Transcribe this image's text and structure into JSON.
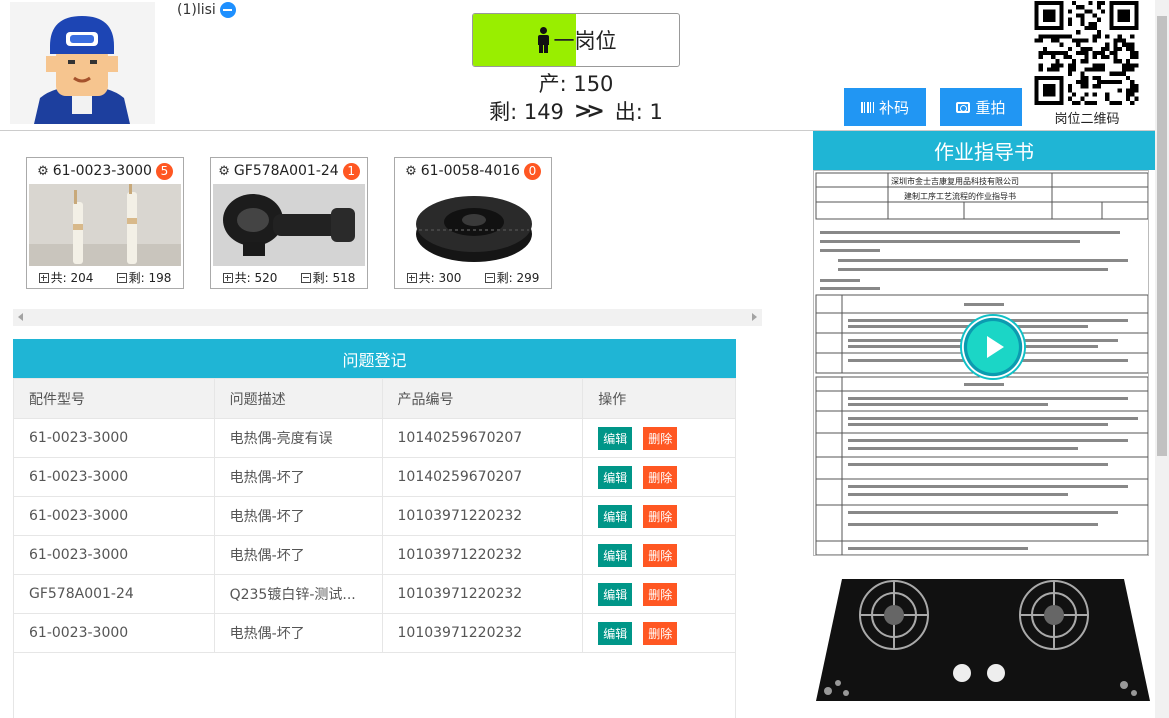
{
  "user": {
    "name": "(1)lisi"
  },
  "post": {
    "label": "一岗位",
    "fill_percent": 50
  },
  "production": {
    "produce_label": "产: 150",
    "remain_label": "剩: 149",
    "out_label": "出: 1"
  },
  "buttons": {
    "barcode": "补码",
    "retake": "重拍"
  },
  "qr": {
    "label": "岗位二维码"
  },
  "parts": [
    {
      "code": "61-0023-3000",
      "badge": "5",
      "total": "共: 204",
      "remain": "剩: 198",
      "image": "heating-rod-photo"
    },
    {
      "code": "GF578A001-24",
      "badge": "1",
      "total": "共: 520",
      "remain": "剩: 518",
      "image": "burner-body-photo"
    },
    {
      "code": "61-0058-4016",
      "badge": "0",
      "total": "共: 300",
      "remain": "剩: 299",
      "image": "burner-cap-photo"
    }
  ],
  "issues": {
    "title": "问题登记",
    "columns": [
      "配件型号",
      "问题描述",
      "产品编号",
      "操作"
    ],
    "edit_label": "编辑",
    "delete_label": "删除",
    "rows": [
      [
        "61-0023-3000",
        "电热偶-亮度有误",
        "10140259670207"
      ],
      [
        "61-0023-3000",
        "电热偶-坏了",
        "10140259670207"
      ],
      [
        "61-0023-3000",
        "电热偶-坏了",
        "10103971220232"
      ],
      [
        "61-0023-3000",
        "电热偶-坏了",
        "10103971220232"
      ],
      [
        "GF578A001-24",
        "Q235镀白锌-测试...",
        "10103971220232"
      ],
      [
        "61-0023-3000",
        "电热偶-坏了",
        "10103971220232"
      ]
    ]
  },
  "guide": {
    "title": "作业指导书",
    "doc_company": "深圳市金士吉康复用品科技有限公司",
    "doc_title": "建制工序工艺流程的作业指导书"
  },
  "colors": {
    "accent": "#1fb5d5",
    "edit": "#009688",
    "delete": "#ff5722",
    "primary": "#2196f3",
    "post_fill": "#99ee00"
  }
}
